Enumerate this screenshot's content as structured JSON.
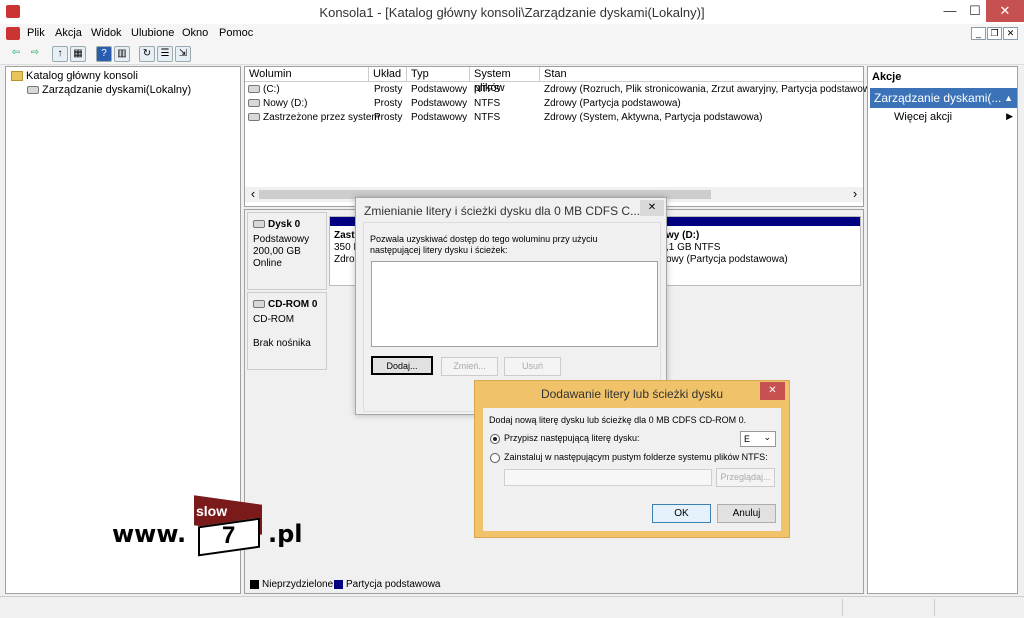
{
  "window": {
    "title": "Konsola1 - [Katalog główny konsoli\\Zarządzanie dyskami(Lokalny)]",
    "minimize_glyph": "—",
    "maximize_glyph": "☐",
    "close_glyph": "✕"
  },
  "menu": {
    "items": [
      "Plik",
      "Akcja",
      "Widok",
      "Ulubione",
      "Okno",
      "Pomoc"
    ],
    "mdi_minimize": "_",
    "mdi_restore": "❐",
    "mdi_close": "✕"
  },
  "toolbar": {
    "icons": [
      "back-arrow-icon",
      "forward-arrow-icon",
      "up-folder-icon",
      "show-hide-tree-icon",
      "help-icon",
      "show-hide-action-pane-icon",
      "refresh-icon",
      "properties-icon",
      "export-list-icon"
    ],
    "glyphs": [
      "⇦",
      "⇨",
      "↑",
      "▦",
      "?",
      "▥",
      "↻",
      "☰",
      "⇲"
    ]
  },
  "tree": {
    "root": "Katalog główny konsoli",
    "child": "Zarządzanie dyskami(Lokalny)"
  },
  "volumes": {
    "columns": [
      "Wolumin",
      "Układ",
      "Typ",
      "System plików",
      "Stan"
    ],
    "rows": [
      {
        "volume": "(C:)",
        "layout": "Prosty",
        "type": "Podstawowy",
        "fs": "NTFS",
        "status": "Zdrowy (Rozruch, Plik stronicowania, Zrzut awaryjny, Partycja podstawowa)"
      },
      {
        "volume": "Nowy (D:)",
        "layout": "Prosty",
        "type": "Podstawowy",
        "fs": "NTFS",
        "status": "Zdrowy (Partycja podstawowa)"
      },
      {
        "volume": "Zastrzeżone przez system",
        "layout": "Prosty",
        "type": "Podstawowy",
        "fs": "NTFS",
        "status": "Zdrowy (System, Aktywna, Partycja podstawowa)"
      }
    ],
    "scroll_left": "‹",
    "scroll_right": "›"
  },
  "disks": {
    "disk0": {
      "name": "Dysk 0",
      "type": "Podstawowy",
      "size": "200,00 GB",
      "state": "Online"
    },
    "disk0_part1": {
      "name": "Zastr",
      "size": "350 M",
      "status": "Zdro"
    },
    "disk0_part2": {
      "name": "wy  (D:)",
      "size": ",1 GB NTFS",
      "status": "owy (Partycja podstawowa)"
    },
    "cdrom0": {
      "name": "CD-ROM 0",
      "type": "CD-ROM",
      "media": "Brak nośnika"
    }
  },
  "legend": {
    "unallocated": "Nieprzydzielone",
    "primary": "Partycja podstawowa",
    "unallocated_color": "#000000",
    "primary_color": "#000080"
  },
  "actions": {
    "header": "Akcje",
    "section": "Zarządzanie dyskami(...",
    "more": "Więcej akcji",
    "section_arrow": "▲",
    "more_arrow": "▶"
  },
  "dialog_change": {
    "title": "Zmienianie litery i ścieżki dysku dla 0 MB CDFS  C...",
    "description": "Pozwala uzyskiwać dostęp do tego woluminu przy użyciu następującej litery dysku i ścieżek:",
    "add_button": "Dodaj...",
    "change_button": "Zmień...",
    "remove_button": "Usuń",
    "close_glyph": "✕"
  },
  "dialog_add": {
    "title": "Dodawanie litery lub ścieżki dysku",
    "description": "Dodaj nową literę dysku lub ścieżkę dla 0 MB CDFS  CD-ROM 0.",
    "option_letter": "Przypisz następującą literę dysku:",
    "option_folder": "Zainstaluj w następującym pustym folderze systemu plików NTFS:",
    "letter_value": "E",
    "browse_button": "Przeglądaj...",
    "ok_button": "OK",
    "cancel_button": "Anuluj",
    "close_glyph": "✕",
    "dropdown_glyph": "⌄",
    "accent_color": "#f0c36a"
  },
  "watermark": {
    "prefix": "www.",
    "slow": "slow",
    "seven": "7",
    "suffix": ".pl"
  }
}
